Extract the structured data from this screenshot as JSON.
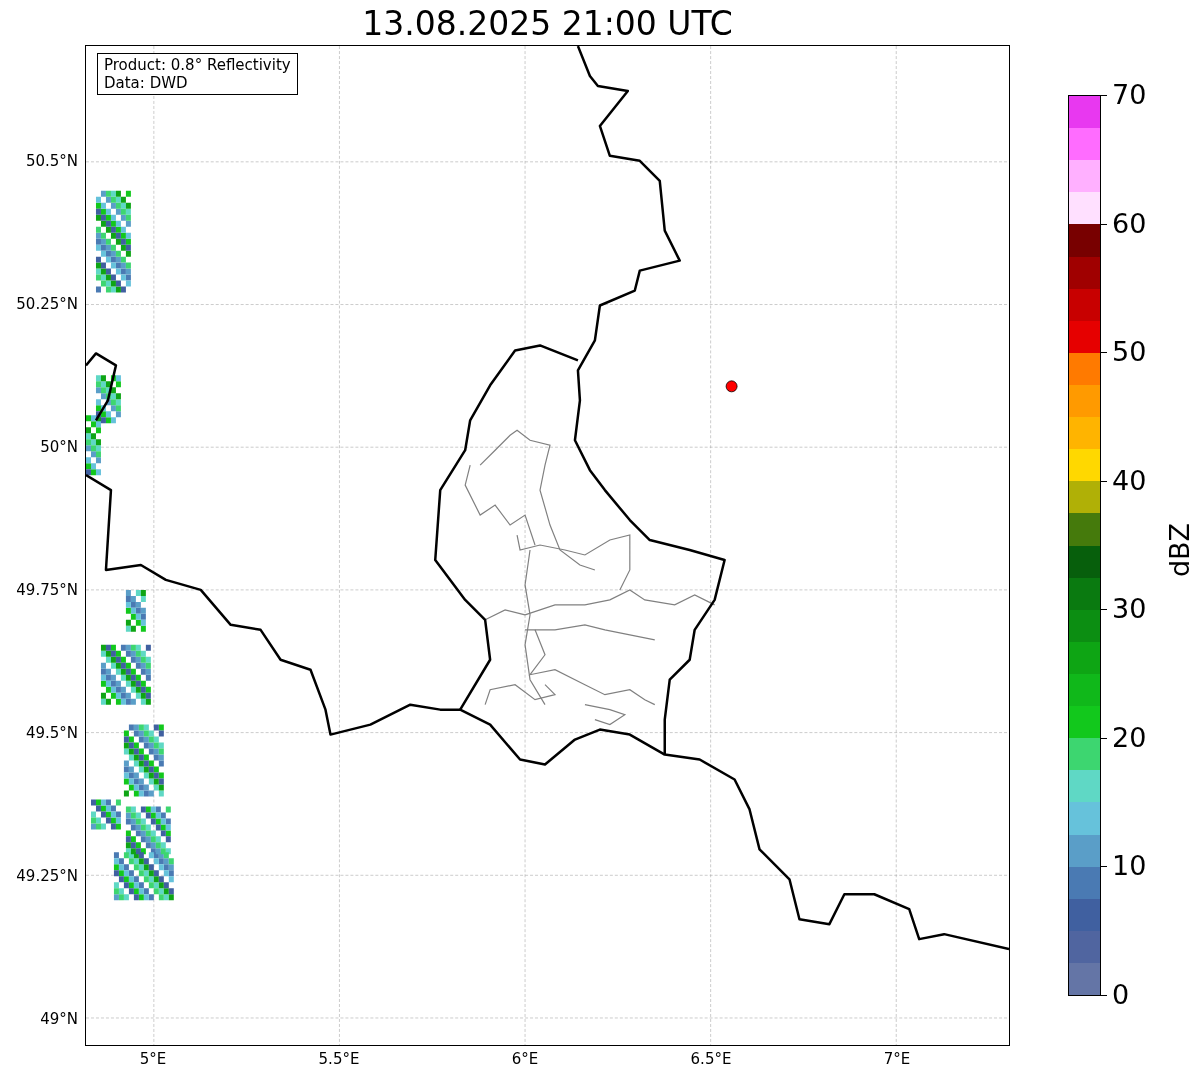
{
  "title": "13.08.2025 21:00 UTC",
  "map": {
    "info_lines": [
      "Product: 0.8° Reflectivity",
      "Data: DWD"
    ],
    "lat_ticks": [
      "50.5°N",
      "50.25°N",
      "50°N",
      "49.75°N",
      "49.5°N",
      "49.25°N",
      "49°N"
    ],
    "lon_ticks": [
      "5°E",
      "5.5°E",
      "6°E",
      "6.5°E",
      "7°E"
    ]
  },
  "colorbar": {
    "label": "dBZ",
    "ticks": [
      "70",
      "60",
      "50",
      "40",
      "30",
      "20",
      "10",
      "0"
    ],
    "bands": [
      {
        "color": "#e838f0"
      },
      {
        "color": "#ff6cff"
      },
      {
        "color": "#ffb0ff"
      },
      {
        "color": "#ffe0ff"
      },
      {
        "color": "#780000"
      },
      {
        "color": "#a00000"
      },
      {
        "color": "#c80000"
      },
      {
        "color": "#e60000"
      },
      {
        "color": "#ff7a00"
      },
      {
        "color": "#ff9a00"
      },
      {
        "color": "#ffb400"
      },
      {
        "color": "#ffd800"
      },
      {
        "color": "#b0b006"
      },
      {
        "color": "#457a0c"
      },
      {
        "color": "#075f0c"
      },
      {
        "color": "#0a7a10"
      },
      {
        "color": "#0c8e12"
      },
      {
        "color": "#0ea514"
      },
      {
        "color": "#10b81a"
      },
      {
        "color": "#12c81c"
      },
      {
        "color": "#3dd670"
      },
      {
        "color": "#5fd8c5"
      },
      {
        "color": "#66c2db"
      },
      {
        "color": "#5a9ec8"
      },
      {
        "color": "#4a7ab3"
      },
      {
        "color": "#4060a0"
      },
      {
        "color": "#5065a0"
      },
      {
        "color": "#6475a6"
      }
    ]
  }
}
